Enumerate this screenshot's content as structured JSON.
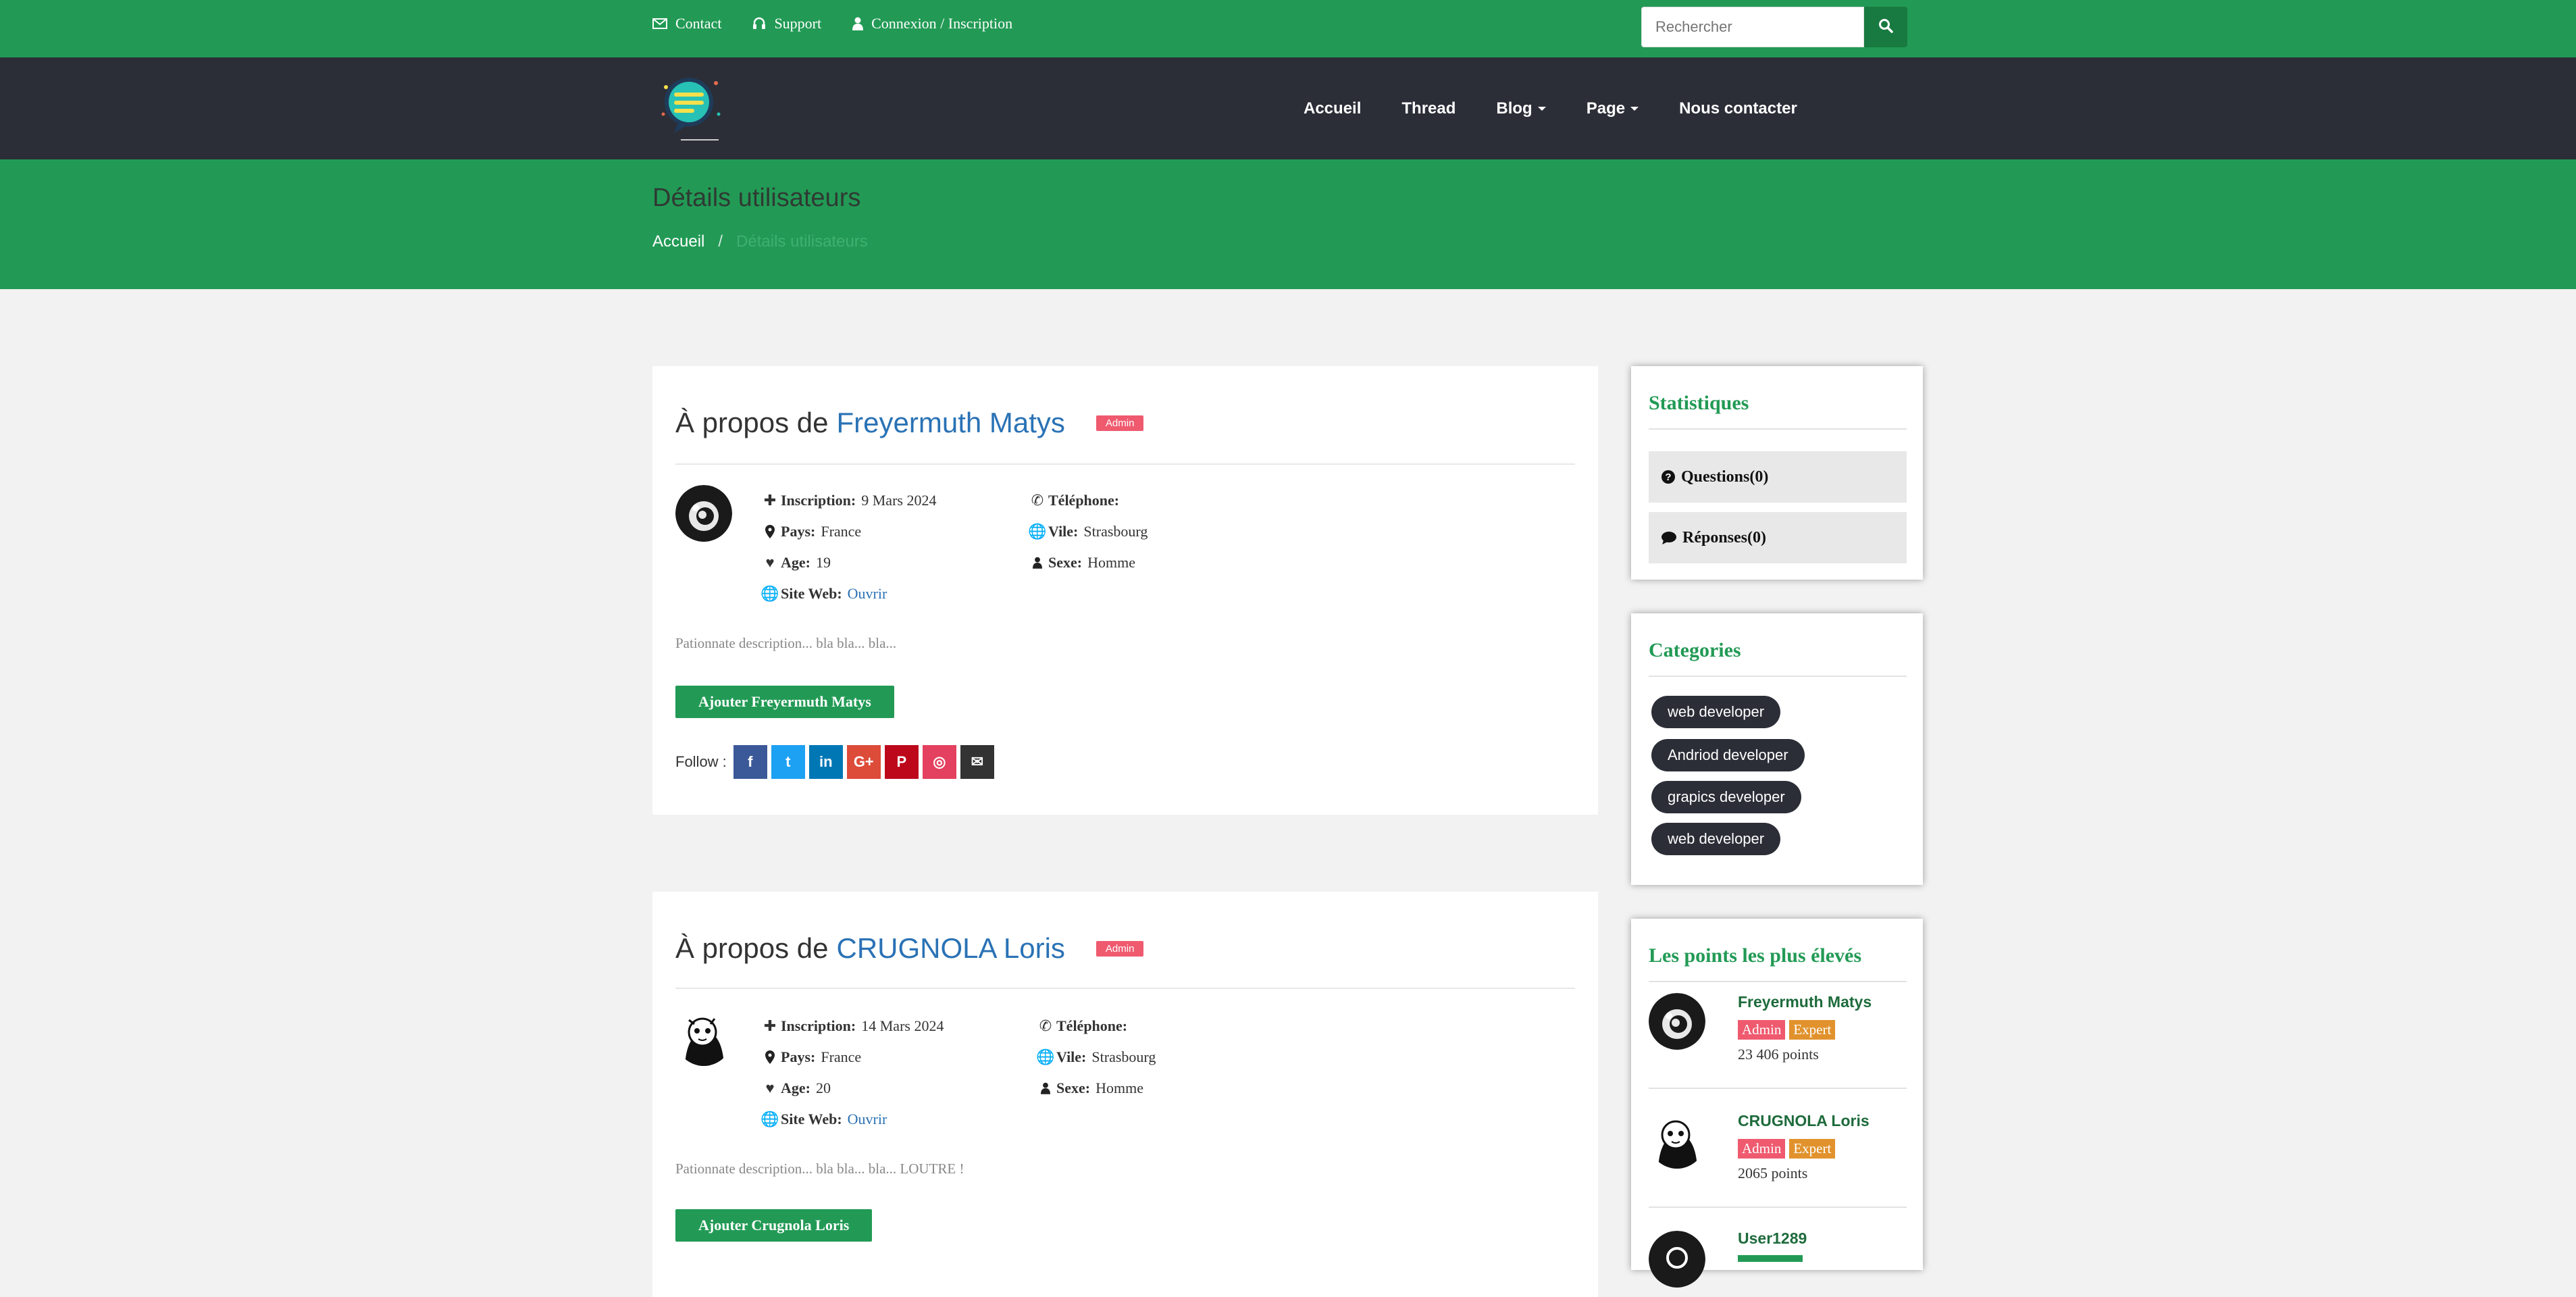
{
  "topbar": {
    "links": [
      {
        "label": "Contact",
        "icon": "envelope-icon"
      },
      {
        "label": "Support",
        "icon": "headset-icon"
      },
      {
        "label": "Connexion / Inscription",
        "icon": "user-icon"
      }
    ],
    "search_placeholder": "Rechercher",
    "color": "#229a55"
  },
  "nav": {
    "items": [
      {
        "label": "Accueil"
      },
      {
        "label": "Thread"
      },
      {
        "label": "Blog"
      },
      {
        "label": "Page"
      },
      {
        "label": "Nous contacter"
      }
    ]
  },
  "banner": {
    "title": "Détails utilisateurs",
    "breadcrumb_home": "Accueil",
    "breadcrumb_sep": "/",
    "breadcrumb_current": "Détails utilisateurs"
  },
  "profiles": [
    {
      "about_prefix": "À propos de",
      "name": "Freyermuth Matys",
      "badge": "Admin",
      "inscription_label": "Inscription:",
      "inscription": "9 Mars 2024",
      "pays_label": "Pays:",
      "pays": "France",
      "age_label": "Age:",
      "age": "19",
      "site_label": "Site Web:",
      "site": "Ouvrir",
      "tel_label": "Téléphone:",
      "ville_label": "Vile:",
      "ville": "Strasbourg",
      "sexe_label": "Sexe:",
      "sexe": "Homme",
      "description": "Pationnate description... bla bla... bla...",
      "add_button": "Ajouter Freyermuth Matys",
      "follow_label": "Follow :"
    },
    {
      "about_prefix": "À propos de",
      "name": "CRUGNOLA Loris",
      "badge": "Admin",
      "inscription_label": "Inscription:",
      "inscription": "14 Mars 2024",
      "pays_label": "Pays:",
      "pays": "France",
      "age_label": "Age:",
      "age": "20",
      "site_label": "Site Web:",
      "site": "Ouvrir",
      "tel_label": "Téléphone:",
      "ville_label": "Vile:",
      "ville": "Strasbourg",
      "sexe_label": "Sexe:",
      "sexe": "Homme",
      "description": "Pationnate description... bla bla... bla... LOUTRE !",
      "add_button": "Ajouter Crugnola Loris"
    }
  ],
  "social": [
    {
      "icon": "facebook-icon",
      "glyph": "f",
      "color": "#3b5998"
    },
    {
      "icon": "twitter-icon",
      "glyph": "t",
      "color": "#1da1f2"
    },
    {
      "icon": "linkedin-icon",
      "glyph": "in",
      "color": "#0077b5"
    },
    {
      "icon": "google-plus-icon",
      "glyph": "G+",
      "color": "#dd4b39"
    },
    {
      "icon": "pinterest-icon",
      "glyph": "P",
      "color": "#bd081c"
    },
    {
      "icon": "instagram-icon",
      "glyph": "◎",
      "color": "#e4405f"
    },
    {
      "icon": "email-icon",
      "glyph": "✉",
      "color": "#333333"
    }
  ],
  "sidebar": {
    "stats_title": "Statistiques",
    "questions": "Questions(0)",
    "reponses": "Réponses(0)",
    "categories_title": "Categories",
    "categories": [
      "web developer",
      "Andriod developer",
      "grapics developer",
      "web developer"
    ],
    "top_title": "Les points les plus élevés",
    "top_users": [
      {
        "name": "Freyermuth Matys",
        "badge1": "Admin",
        "badge2": "Expert",
        "points": "23 406 points"
      },
      {
        "name": "CRUGNOLA Loris",
        "badge1": "Admin",
        "badge2": "Expert",
        "points": "2065 points"
      },
      {
        "name": "User1289"
      }
    ]
  }
}
